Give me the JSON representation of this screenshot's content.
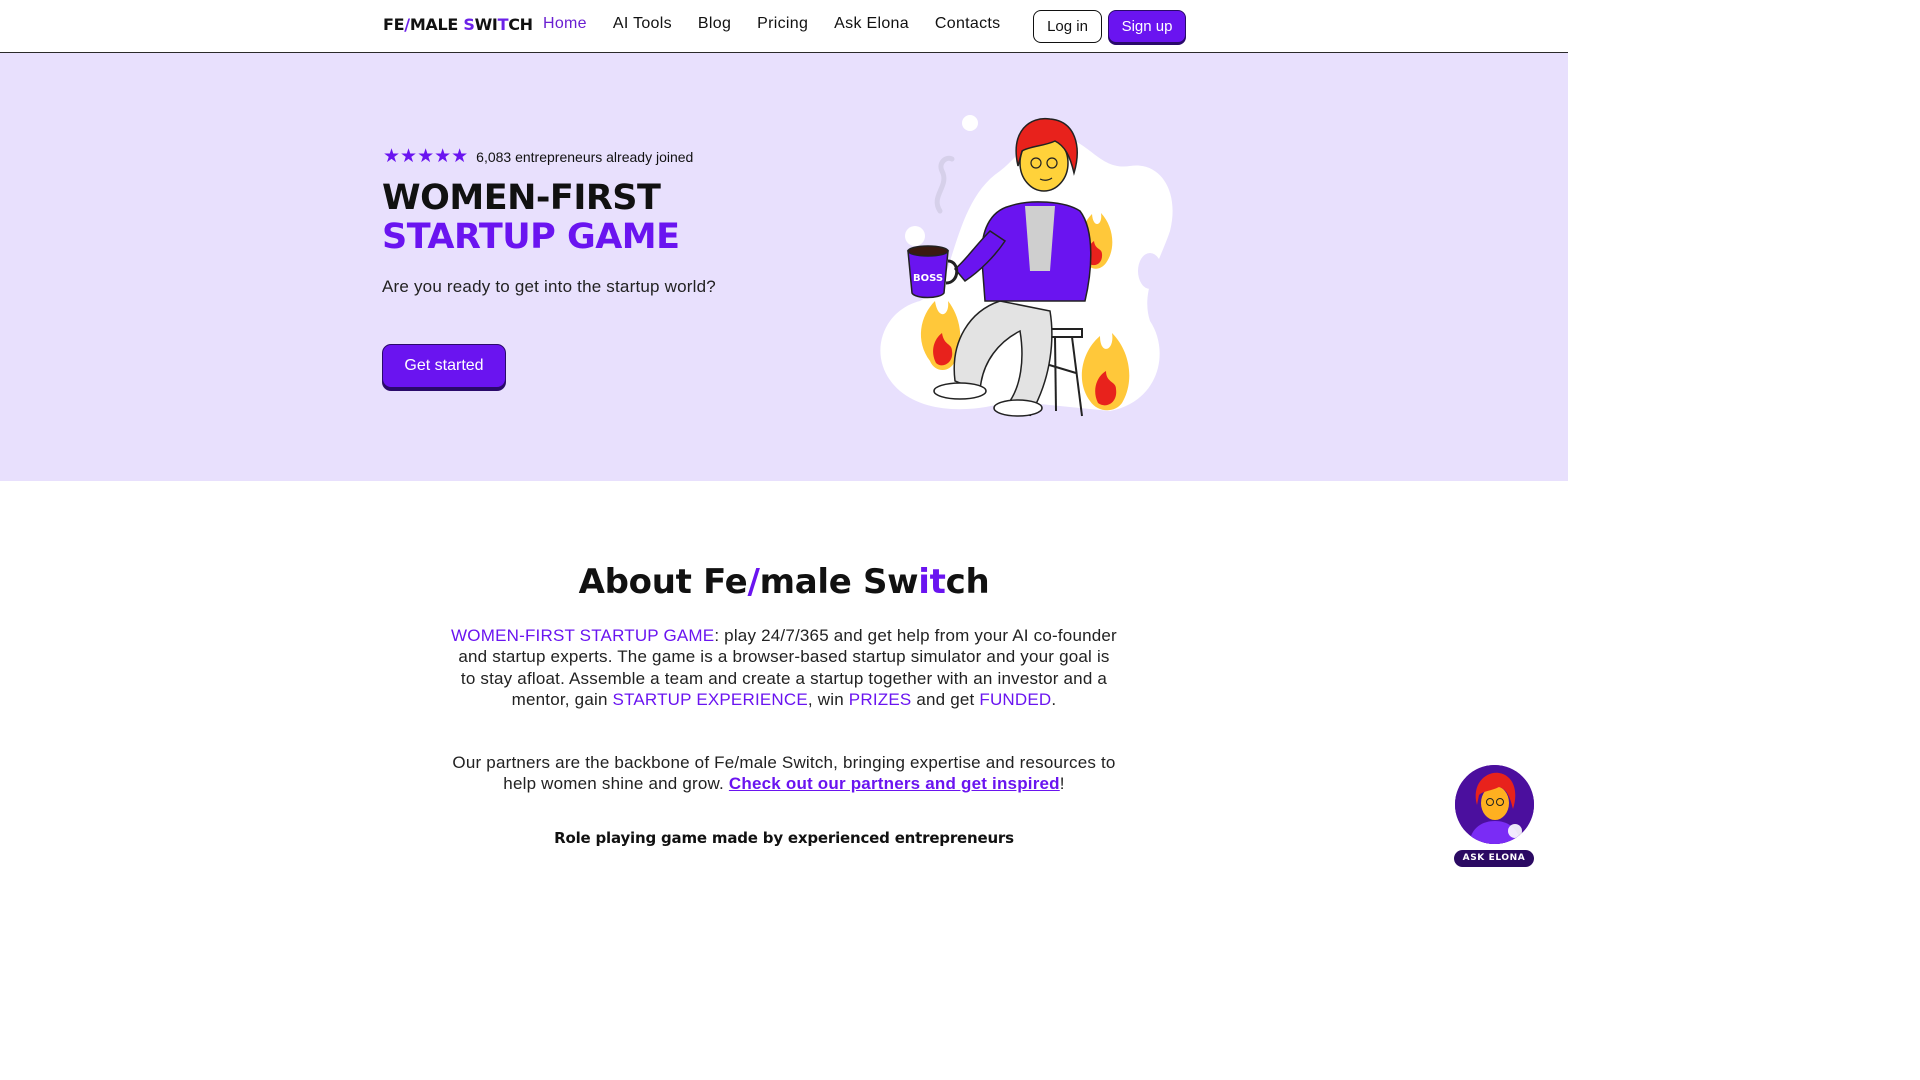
{
  "nav": {
    "logo": {
      "part1": "FE",
      "slash": "/",
      "part2": "MALE ",
      "s": "S",
      "part3": "WI",
      "t": "T",
      "part4": "CH"
    },
    "links": [
      "Home",
      "AI Tools",
      "Blog",
      "Pricing",
      "Ask Elona",
      "Contacts"
    ],
    "login": "Log in",
    "signup": "Sign up"
  },
  "hero": {
    "stars": "★★★★★",
    "rating_text": "6,083 entrepreneurs already joined",
    "title_line1": "WOMEN-FIRST",
    "title_line2": "STARTUP GAME",
    "subtitle": "Are you ready to get into the startup world?",
    "cta": "Get started",
    "mug_text": "BOSS"
  },
  "about": {
    "title": {
      "a": "About Fe",
      "slash": "/",
      "b": "male Sw",
      "it": "it",
      "c": "ch"
    },
    "p1": {
      "hl1": "WOMEN-FIRST STARTUP GAME",
      "t1": ": play 24/7/365 and get help from your AI co-founder and startup experts. The game is a browser-based startup simulator and your goal is to stay afloat. Assemble a team and create a startup together with an investor and a mentor, gain ",
      "hl2": "STARTUP EXPERIENCE",
      "t2": ", win ",
      "hl3": "PRIZES",
      "t3": " and get ",
      "hl4": "FUNDED",
      "t4": "."
    },
    "p2": {
      "t1": "Our partners are the backbone of Fe/male Switch, bringing expertise and resources to help women shine and grow. ",
      "link": "Check out our partners and get inspired",
      "t2": "!"
    },
    "tagline": "Role playing game made by experienced entrepreneurs"
  },
  "widget": {
    "label": "ASK ELONA"
  },
  "colors": {
    "accent": "#6a14f0",
    "hero_bg": "#e8e0fd",
    "dark_accent": "#2a0a6b"
  }
}
